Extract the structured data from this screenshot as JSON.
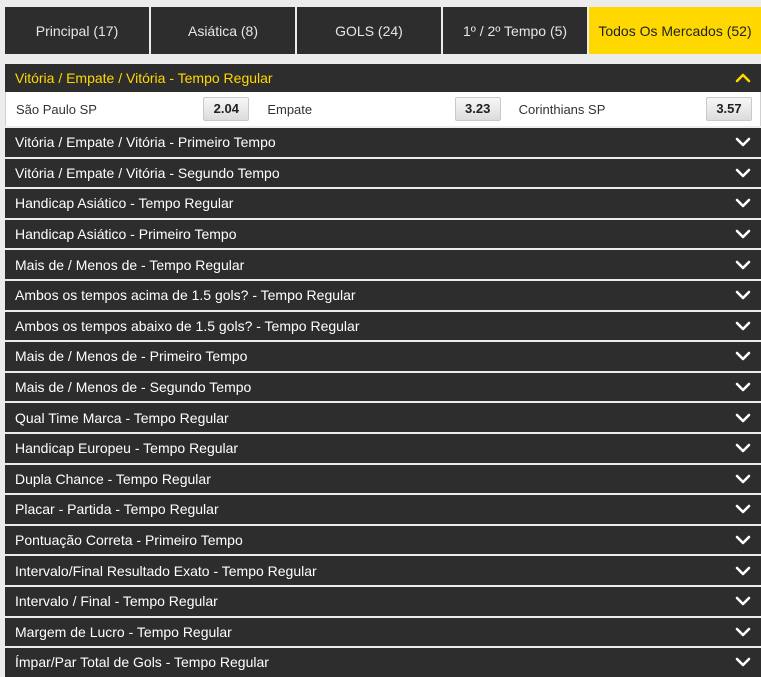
{
  "tabs": [
    {
      "label": "Principal (17)",
      "active": false
    },
    {
      "label": "Asiática (8)",
      "active": false
    },
    {
      "label": "GOLS (24)",
      "active": false
    },
    {
      "label": "1º / 2º Tempo (5)",
      "active": false
    },
    {
      "label": "Todos Os Mercados (52)",
      "active": true
    }
  ],
  "open_market": {
    "title": "Vitória / Empate / Vitória - Tempo Regular",
    "odds": [
      {
        "name": "São Paulo SP",
        "value": "2.04"
      },
      {
        "name": "Empate",
        "value": "3.23"
      },
      {
        "name": "Corinthians SP",
        "value": "3.57"
      }
    ]
  },
  "markets": [
    "Vitória / Empate / Vitória - Primeiro Tempo",
    "Vitória / Empate / Vitória - Segundo Tempo",
    "Handicap Asiático - Tempo Regular",
    "Handicap Asiático - Primeiro Tempo",
    "Mais de / Menos de - Tempo Regular",
    "Ambos os tempos acima de 1.5 gols? - Tempo Regular",
    "Ambos os tempos abaixo de 1.5 gols? - Tempo Regular",
    "Mais de / Menos de - Primeiro Tempo",
    "Mais de / Menos de - Segundo Tempo",
    "Qual Time Marca - Tempo Regular",
    "Handicap Europeu - Tempo Regular",
    "Dupla Chance - Tempo Regular",
    "Placar - Partida - Tempo Regular",
    "Pontuação Correta - Primeiro Tempo",
    "Intervalo/Final Resultado Exato - Tempo Regular",
    "Intervalo / Final - Tempo Regular",
    "Margem de Lucro - Tempo Regular",
    "Ímpar/Par Total de Gols - Tempo Regular"
  ],
  "colors": {
    "accent": "#ffd800",
    "bar": "#2d2d2d",
    "background": "#ececec"
  },
  "icons": {
    "expanded": "chevron-up-icon",
    "collapsed": "chevron-down-icon"
  }
}
